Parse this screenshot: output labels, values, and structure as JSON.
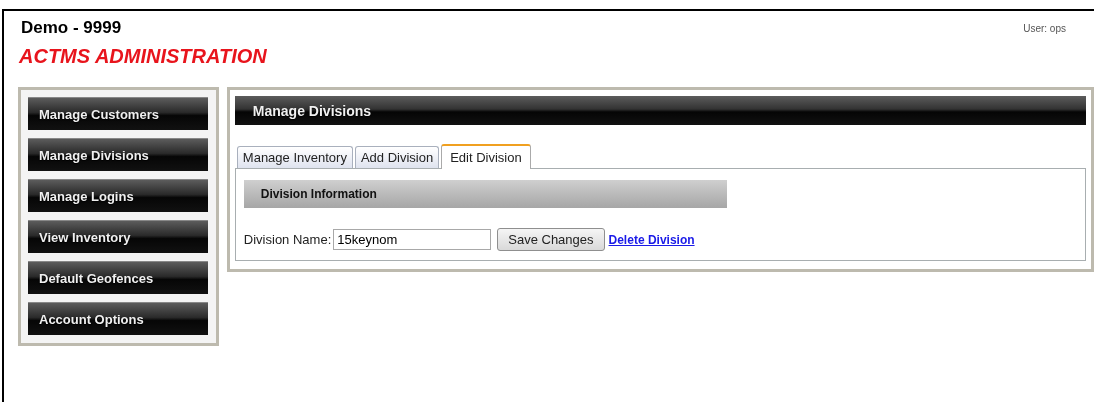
{
  "header": {
    "title": "Demo - 9999",
    "subtitle": "ACTMS ADMINISTRATION",
    "user": "User: ops"
  },
  "sidebar": {
    "items": [
      {
        "label": "Manage Customers"
      },
      {
        "label": "Manage Divisions"
      },
      {
        "label": "Manage Logins"
      },
      {
        "label": "View Inventory"
      },
      {
        "label": "Default Geofences"
      },
      {
        "label": "Account Options"
      }
    ]
  },
  "main": {
    "title": "Manage Divisions",
    "tabs": [
      {
        "label": "Manage Inventory",
        "selected": false
      },
      {
        "label": "Add Division",
        "selected": false
      },
      {
        "label": "Edit Division",
        "selected": true
      }
    ],
    "section_title": "Division Information",
    "field": {
      "label": "Division Name:",
      "value": "15keynom"
    },
    "save_button": "Save Changes",
    "delete_link": "Delete Division"
  }
}
